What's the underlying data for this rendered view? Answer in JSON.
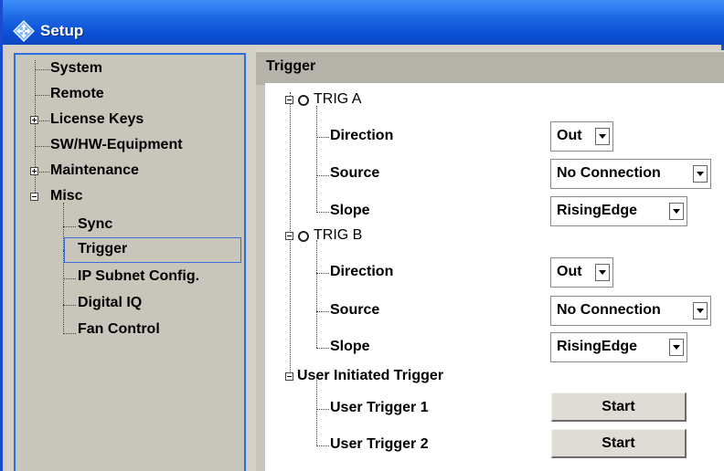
{
  "window": {
    "title": "Setup",
    "icon": "diamond-arrows-icon"
  },
  "tree": {
    "items": [
      {
        "label": "System"
      },
      {
        "label": "Remote"
      },
      {
        "label": "License Keys"
      },
      {
        "label": "SW/HW-Equipment"
      },
      {
        "label": "Maintenance"
      },
      {
        "label": "Misc"
      },
      {
        "label": "Sync"
      },
      {
        "label": "Trigger"
      },
      {
        "label": "IP Subnet Config."
      },
      {
        "label": "Digital IQ"
      },
      {
        "label": "Fan Control"
      }
    ],
    "selected": "Trigger"
  },
  "panel": {
    "header": "Trigger",
    "trig_a": {
      "label": "TRIG A",
      "direction_label": "Direction",
      "direction_value": "Out",
      "source_label": "Source",
      "source_value": "No Connection",
      "slope_label": "Slope",
      "slope_value": "RisingEdge"
    },
    "trig_b": {
      "label": "TRIG B",
      "direction_label": "Direction",
      "direction_value": "Out",
      "source_label": "Source",
      "source_value": "No Connection",
      "slope_label": "Slope",
      "slope_value": "RisingEdge"
    },
    "user": {
      "label": "User Initiated Trigger",
      "trigger1_label": "User Trigger 1",
      "trigger1_button": "Start",
      "trigger2_label": "User Trigger 2",
      "trigger2_button": "Start"
    }
  },
  "colors": {
    "title_bar": "#1c68e4",
    "panel_background": "#c8c5ba",
    "selection_border": "#3a6ed8"
  }
}
